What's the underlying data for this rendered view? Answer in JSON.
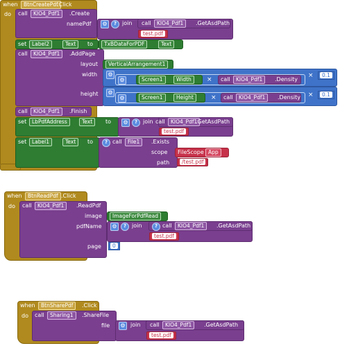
{
  "event1": {
    "when": "when",
    "component": "BtnCreatePdf",
    "event": ".Click",
    "do": "do",
    "create_call": "call",
    "create_comp": "KIO4_Pdf1",
    "create_method": ".Create",
    "pdfname_label": "namePdf",
    "join_label": "join",
    "getasd_call": "call",
    "getasd_comp": "KIO4_Pdf1",
    "getasd_method": ".GetAsdPath",
    "testpdf": "test.pdf",
    "set_label": "set",
    "label2": "Label2",
    "text_prop": "Text",
    "to": "to",
    "txb": "TxBDataForPDF",
    "txb_prop": "Text",
    "addpage_call": "call",
    "addpage_comp": "KIO4_Pdf1",
    "addpage_method": ".AddPage",
    "layout_label": "layout",
    "layout_value": "VerticalArrangement1",
    "width_label": "width",
    "height_label": "height",
    "screen": "Screen1",
    "width_prop": "Width",
    "height_prop": "Height",
    "density_call": "call",
    "density_comp": "KIO4_Pdf1",
    "density_method": ".Density",
    "mult": "×",
    "factor": "0.1",
    "finish_call": "call",
    "finish_comp": "KIO4_Pdf1",
    "finish_method": ".Finish",
    "set2_label": "set",
    "lbpdf": "LbPdfAddress",
    "lbpdf_prop": "Text",
    "to2": "to",
    "set3_label": "set",
    "label1": "Label1",
    "label1_prop": "Text",
    "to3": "to",
    "exists_call": "call",
    "exists_comp": "File1",
    "exists_method": ".Exists",
    "scope_label": "scope",
    "filescope": "FileScope",
    "scope_value": "App",
    "path_label": "path",
    "path_value": "/test.pdf"
  },
  "event2": {
    "when": "when",
    "component": "BtnReadPdf",
    "event": ".Click",
    "do": "do",
    "call": "call",
    "comp": "KIO4_Pdf1",
    "method": ".ReadPdf",
    "image_label": "image",
    "image_value": "ImageForPdfRead",
    "pdfname_label": "pdfName",
    "join_label": "join",
    "getasd_call": "call",
    "getasd_comp": "KIO4_Pdf1",
    "getasd_method": ".GetAsdPath",
    "testpdf": "test.pdf",
    "page_label": "page",
    "page_value": "0"
  },
  "event3": {
    "when": "when",
    "component": "BtnSharePdf",
    "event": ".Click",
    "do": "do",
    "call": "call",
    "comp": "Sharing1",
    "method": ".ShareFile",
    "file_label": "file",
    "join_label": "join",
    "getasd_call": "call",
    "getasd_comp": "KIO4_Pdf1",
    "getasd_method": ".GetAsdPath",
    "testpdf": "test.pdf"
  }
}
